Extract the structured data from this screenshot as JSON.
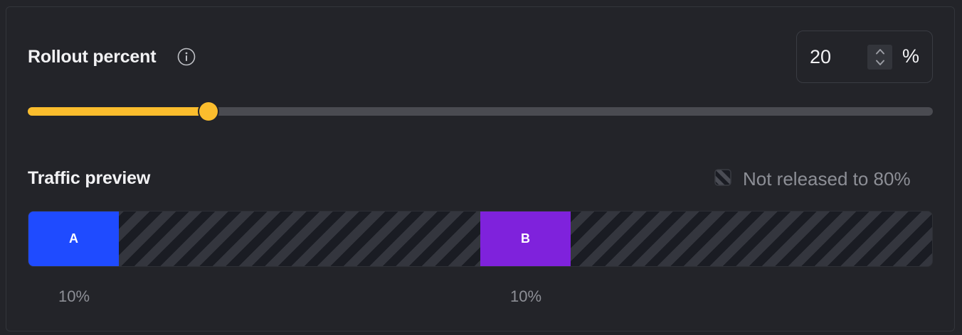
{
  "rollout": {
    "title": "Rollout percent",
    "value": "20",
    "unit": "%",
    "percent": 20,
    "slider_color": "#fbbd2d",
    "track_color": "#4a4b51"
  },
  "traffic": {
    "title": "Traffic preview",
    "legend_label": "Not released to 80%",
    "segments": [
      {
        "label": "A",
        "percent_label": "10%",
        "share": 10,
        "start": 0,
        "color": "#1f4bff"
      },
      {
        "label": "B",
        "percent_label": "10%",
        "share": 10,
        "start": 50,
        "color": "#7f22dc"
      }
    ],
    "unreleased_share": 80
  },
  "icons": {
    "info": "info-icon",
    "stepper_up": "chevron-up-icon",
    "stepper_down": "chevron-down-icon",
    "legend": "striped-swatch-icon"
  }
}
